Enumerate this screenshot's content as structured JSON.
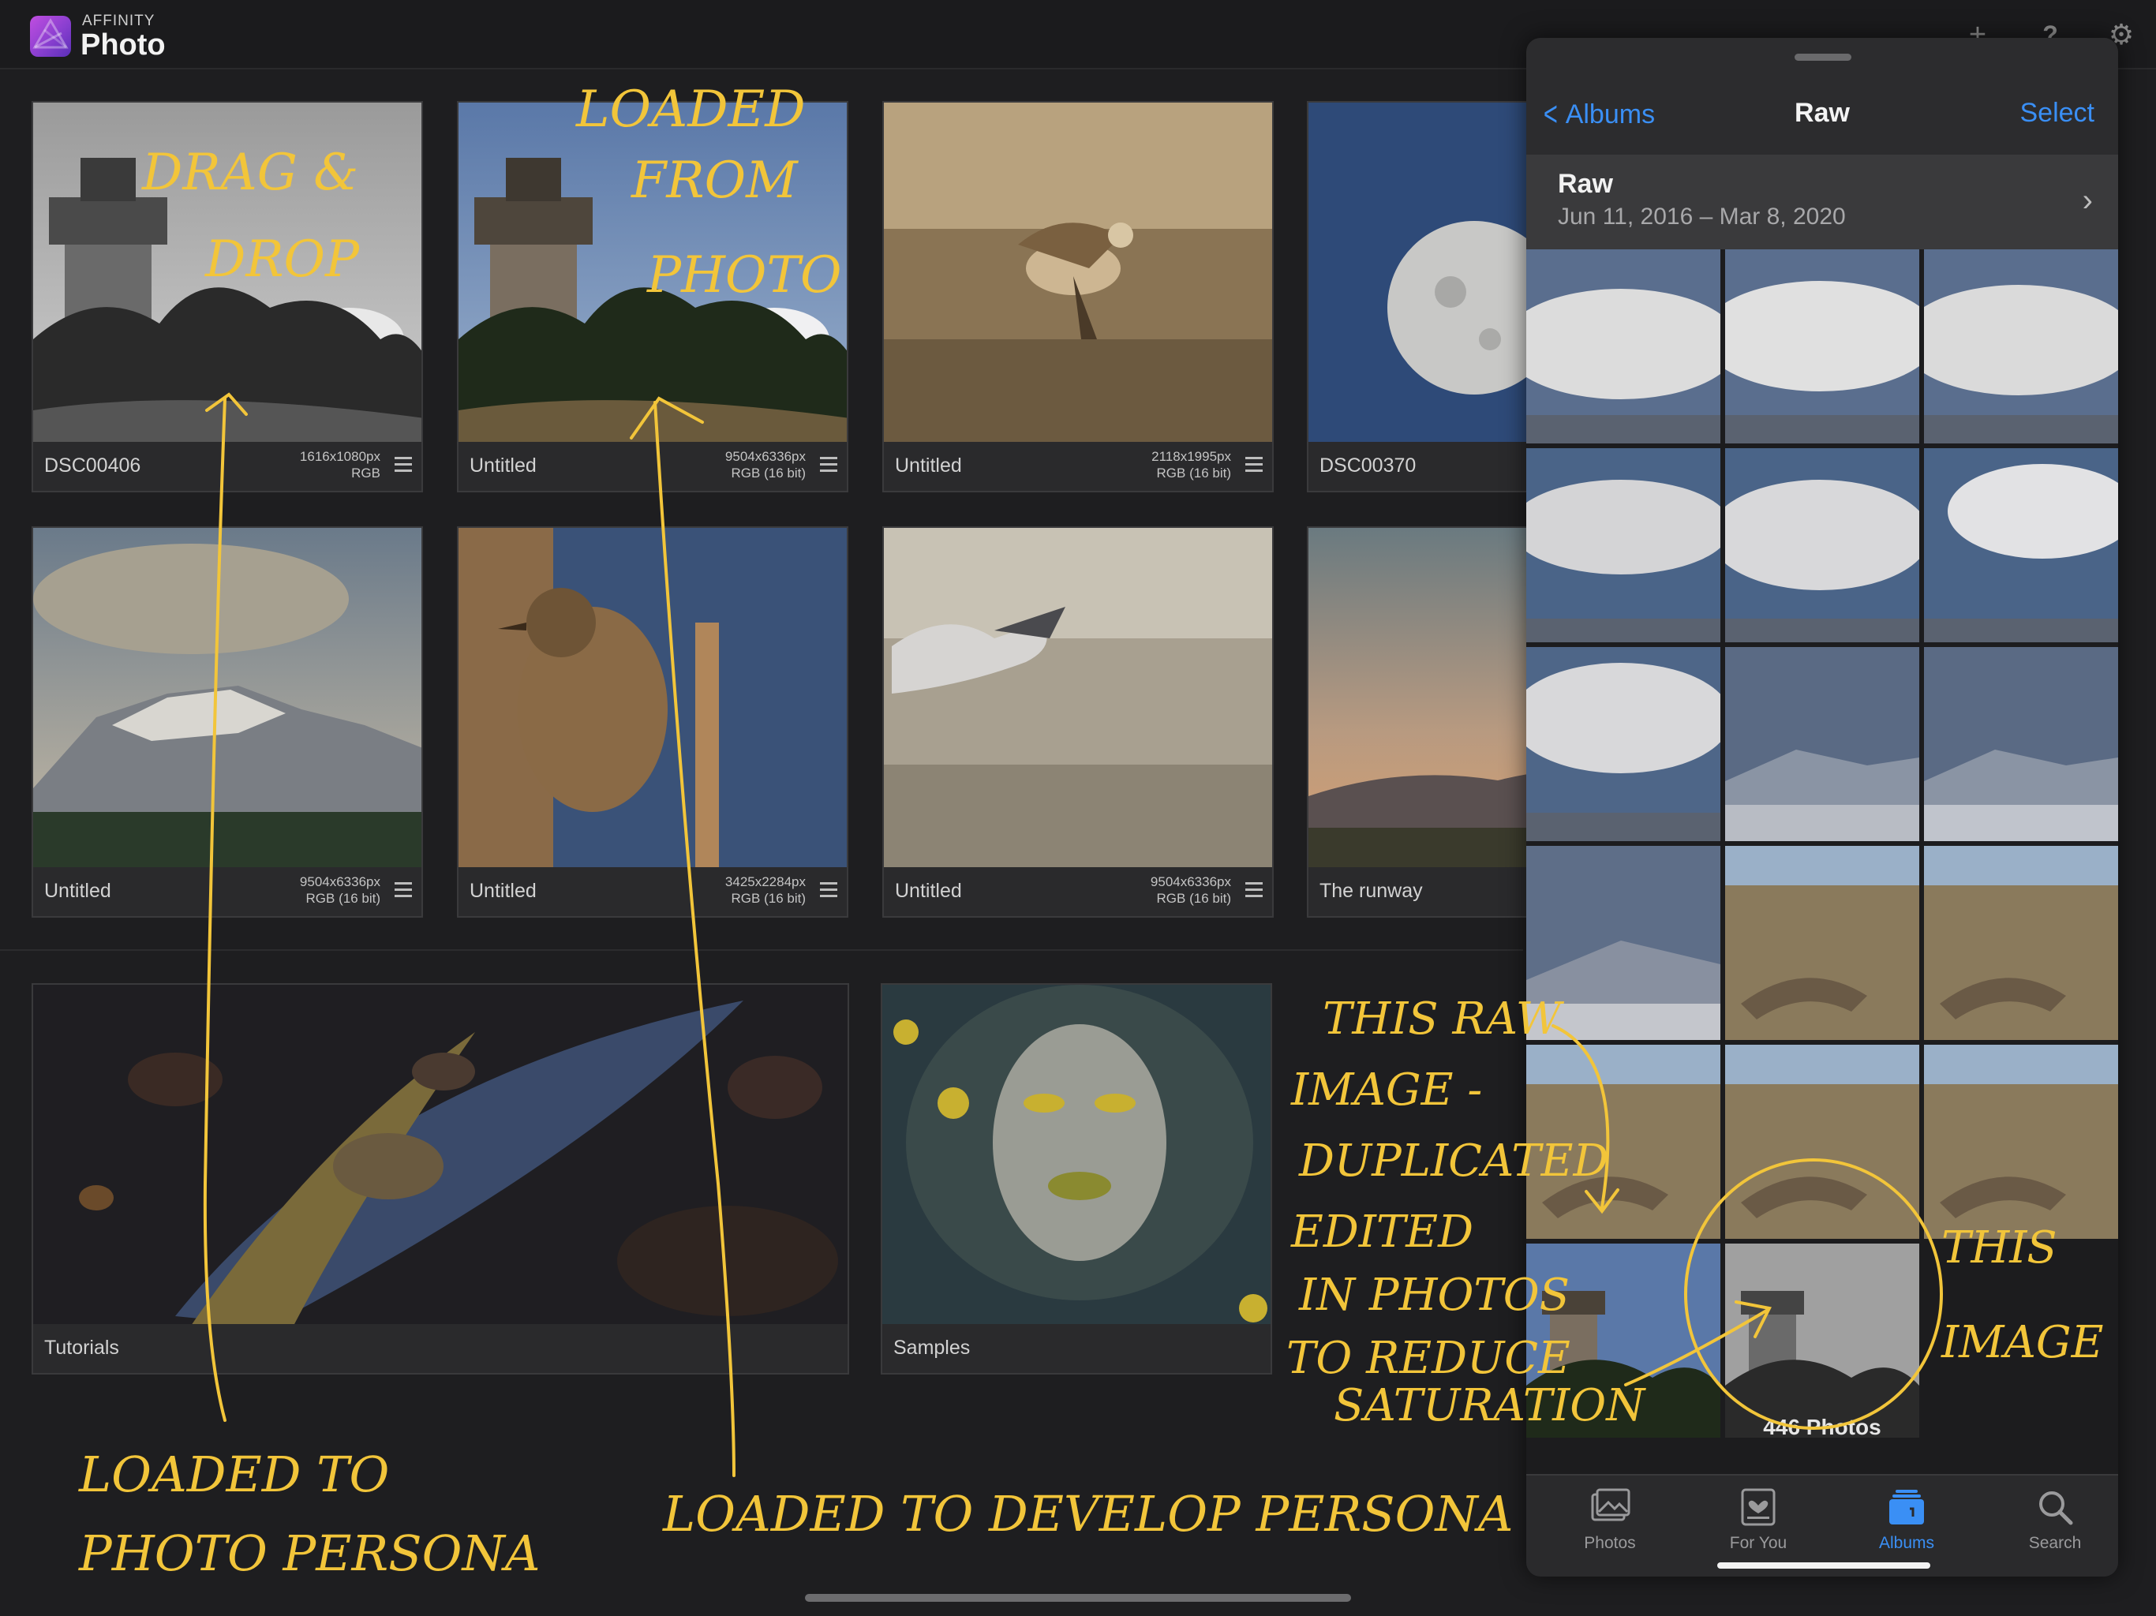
{
  "header": {
    "brand_small": "AFFINITY",
    "brand_big": "Photo",
    "icons": [
      "plus-icon",
      "help-icon",
      "gear-icon"
    ]
  },
  "documents": [
    {
      "name": "DSC00406",
      "size": "1616x1080px",
      "mode": "RGB"
    },
    {
      "name": "Untitled",
      "size": "9504x6336px",
      "mode": "RGB (16 bit)"
    },
    {
      "name": "Untitled",
      "size": "2118x1995px",
      "mode": "RGB (16 bit)"
    },
    {
      "name": "DSC00370",
      "size": "",
      "mode": ""
    },
    {
      "name": "Untitled",
      "size": "9504x6336px",
      "mode": "RGB (16 bit)"
    },
    {
      "name": "Untitled",
      "size": "3425x2284px",
      "mode": "RGB (16 bit)"
    },
    {
      "name": "Untitled",
      "size": "9504x6336px",
      "mode": "RGB (16 bit)"
    },
    {
      "name": "The runway",
      "size": "",
      "mode": ""
    }
  ],
  "extras": [
    {
      "name": "Tutorials"
    },
    {
      "name": "Samples"
    }
  ],
  "picker": {
    "back_label": "Albums",
    "title": "Raw",
    "select_label": "Select",
    "album_name": "Raw",
    "album_dates": "Jun 11, 2016 – Mar 8, 2020",
    "photo_count": "446 Photos",
    "tabs": [
      {
        "label": "Photos",
        "icon": "photos-icon"
      },
      {
        "label": "For You",
        "icon": "for-you-icon"
      },
      {
        "label": "Albums",
        "icon": "albums-icon"
      },
      {
        "label": "Search",
        "icon": "search-icon"
      }
    ],
    "active_tab": "Albums",
    "accent": "#3a8ff5"
  },
  "annotations": {
    "a1": "DRAG &",
    "a2": "DROP",
    "b1": "LOADED",
    "b2": "FROM",
    "b3": "PHOTO",
    "c1": "THIS RAW",
    "c2": "IMAGE -",
    "c3": "DUPLICATED",
    "c4": "EDITED",
    "c5": "IN PHOTOS",
    "c6": "TO REDUCE",
    "c7": "SATURATION",
    "d1": "THIS",
    "d2": "IMAGE",
    "e1": "LOADED TO",
    "e2": "PHOTO PERSONA",
    "f1": "LOADED TO DEVELOP PERSONA",
    "ink_color": "#f2c53a"
  }
}
